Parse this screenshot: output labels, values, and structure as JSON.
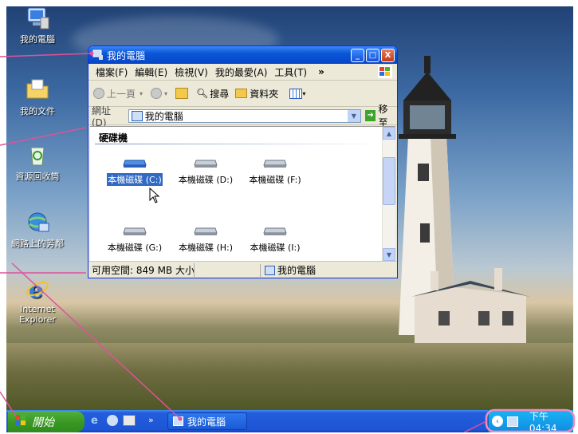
{
  "desktop": {
    "icons": [
      {
        "label": "我的電腦"
      },
      {
        "label": "我的文件"
      },
      {
        "label": "資源回收筒"
      },
      {
        "label": "網路上的芳鄰"
      },
      {
        "label": "Internet Explorer"
      }
    ]
  },
  "window": {
    "title": "我的電腦",
    "buttons": {
      "minimize": "_",
      "maximize": "□",
      "close": "X"
    },
    "menu": [
      "檔案(F)",
      "編輯(E)",
      "檢視(V)",
      "我的最愛(A)",
      "工具(T)"
    ],
    "menu_overflow": "»",
    "toolbar": {
      "back": "上一頁",
      "search": "搜尋",
      "folders": "資料夾"
    },
    "address": {
      "label": "網址(D)",
      "value": "我的電腦",
      "go": "移至"
    },
    "group_header": "硬碟機",
    "drives": [
      {
        "label": "本機磁碟 (C:)",
        "selected": true
      },
      {
        "label": "本機磁碟 (D:)"
      },
      {
        "label": "本機磁碟 (F:)"
      },
      {
        "label": "本機磁碟 (G:)"
      },
      {
        "label": "本機磁碟 (H:)"
      },
      {
        "label": "本機磁碟 (I:)"
      }
    ],
    "status": {
      "free": "可用空間: 849 MB 大小",
      "location": "我的電腦"
    }
  },
  "taskbar": {
    "start_label": "開始",
    "task_label": "我的電腦",
    "clock": "下午 04:34"
  },
  "colors": {
    "titlebar": "#0a58d8",
    "taskbar": "#1d55d6",
    "start": "#3a9a24",
    "tray": "#0f8be0",
    "annotation": "#e0529a"
  }
}
